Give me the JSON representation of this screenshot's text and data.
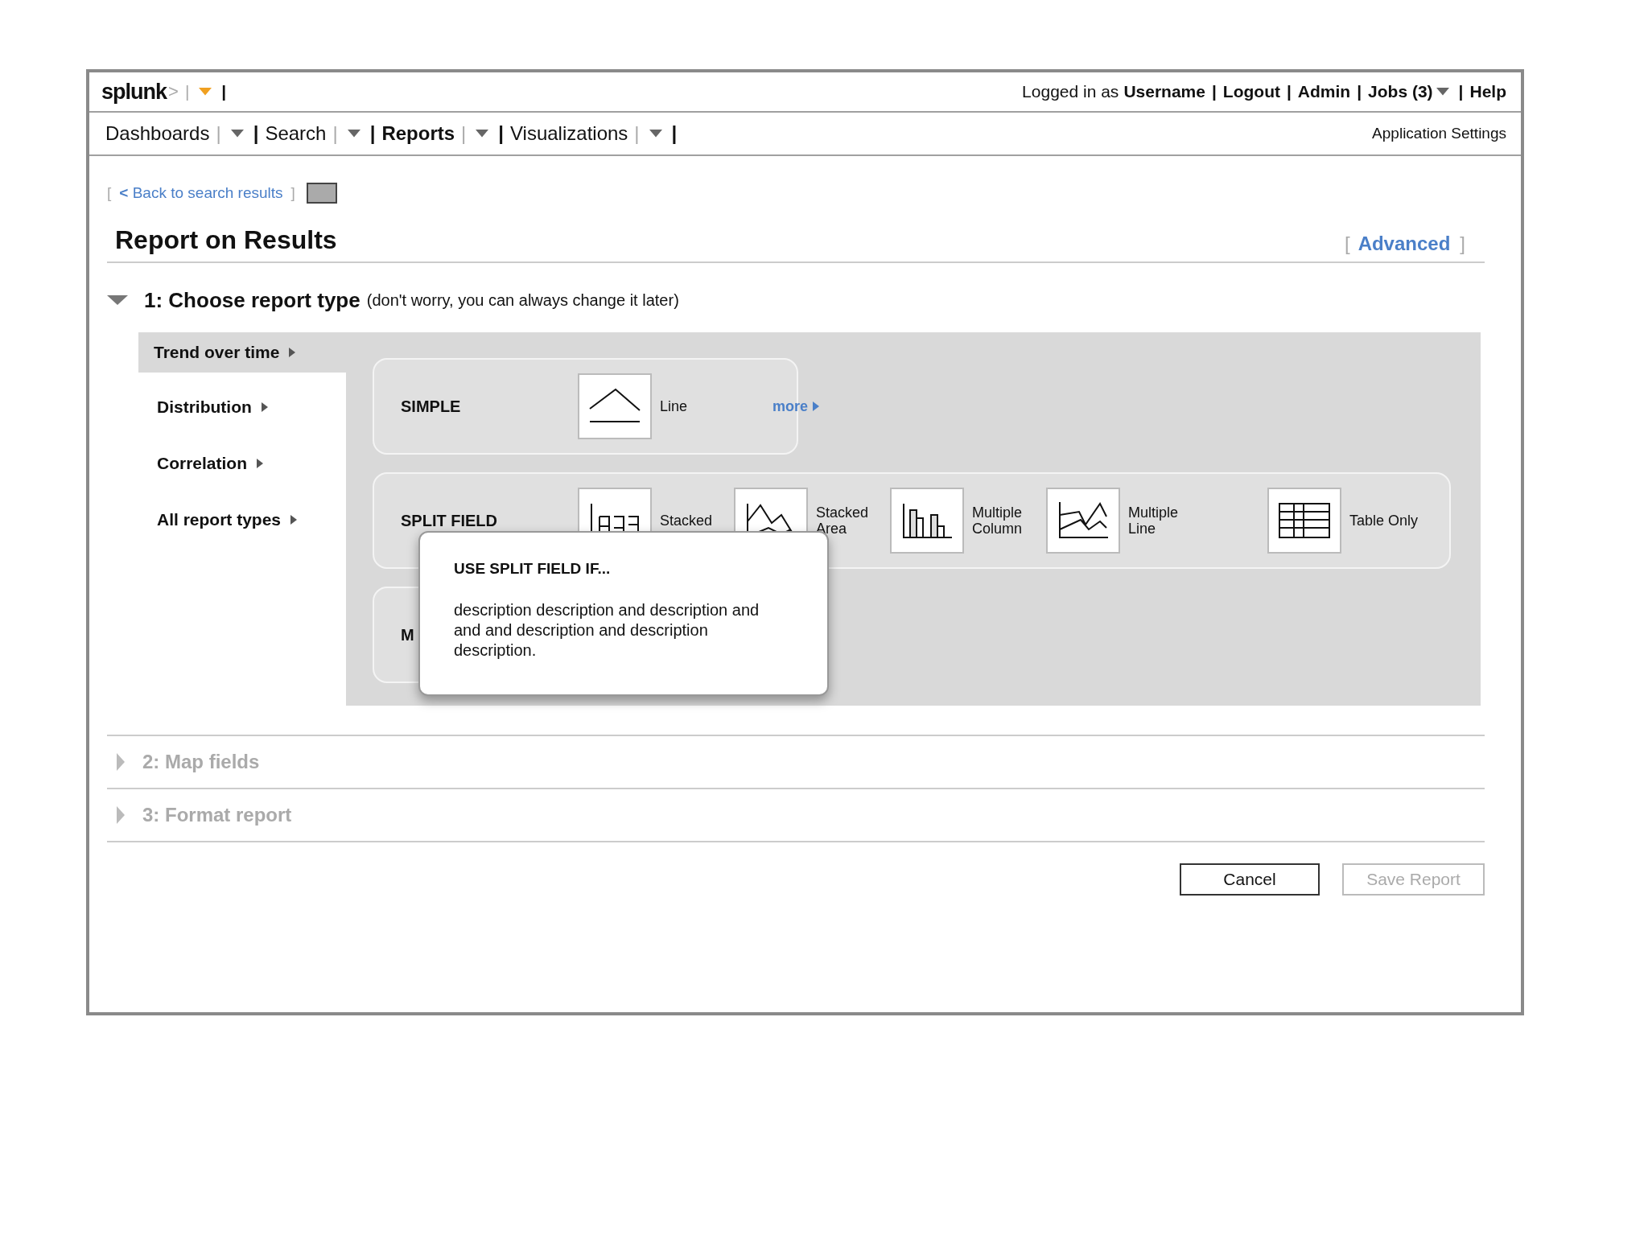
{
  "header": {
    "logo": "splunk",
    "logo_mark": ">",
    "divider": "|",
    "end": "|",
    "account": [
      {
        "kind": "text",
        "text": "Logged in as"
      },
      {
        "kind": "link",
        "text": "Username"
      },
      {
        "kind": "sep",
        "text": "|"
      },
      {
        "kind": "link",
        "text": "Logout"
      },
      {
        "kind": "sep",
        "text": "|"
      },
      {
        "kind": "link",
        "text": "Admin"
      },
      {
        "kind": "sep",
        "text": "|"
      },
      {
        "kind": "link",
        "text": "Jobs (3)"
      },
      {
        "kind": "caret"
      },
      {
        "kind": "sep",
        "text": "|"
      },
      {
        "kind": "link",
        "text": "Help"
      }
    ]
  },
  "nav": {
    "menus": [
      {
        "label": "Dashboards",
        "selected": false,
        "divider": "|",
        "end": "|"
      },
      {
        "label": "Search",
        "selected": false,
        "divider": "|",
        "end": "|"
      },
      {
        "label": "Reports",
        "selected": true,
        "divider": "|",
        "end": "|"
      },
      {
        "label": "Visualizations",
        "selected": false,
        "divider": "|",
        "end": "|"
      }
    ],
    "settings": "Application Settings"
  },
  "back_link": {
    "open": "[",
    "arrow": "<",
    "label": "Back to search results",
    "close": "]"
  },
  "page_title": "Report on Results",
  "advanced": {
    "open": "[",
    "label": "Advanced",
    "close": "]"
  },
  "steps": [
    {
      "title": "1: Choose report type",
      "note": "(don't worry, you can always change it later)",
      "expanded": true
    },
    {
      "title": "2: Map fields",
      "expanded": false
    },
    {
      "title": "3: Format report",
      "expanded": false
    }
  ],
  "categories": [
    {
      "label": "Trend over time",
      "selected": true
    },
    {
      "label": "Distribution",
      "selected": false
    },
    {
      "label": "Correlation",
      "selected": false
    },
    {
      "label": "All report types",
      "selected": false
    }
  ],
  "groups": [
    {
      "label": "SIMPLE",
      "more": "more",
      "types": [
        {
          "kind": "line",
          "label": "Line"
        }
      ]
    },
    {
      "label": "SPLIT FIELD",
      "types": [
        {
          "kind": "stacked_column",
          "label": "Stacked"
        },
        {
          "kind": "stacked_area",
          "label": "Stacked Area"
        },
        {
          "kind": "multi_column",
          "label": "Multiple Column"
        },
        {
          "kind": "multi_line",
          "label": "Multiple Line"
        },
        {
          "kind": "table",
          "label": "Table Only"
        }
      ]
    },
    {
      "label": "M"
    }
  ],
  "tooltip": {
    "title": "USE SPLIT FIELD IF...",
    "body": "description description and description and and and description and description description."
  },
  "buttons": [
    {
      "label": "Cancel",
      "disabled": false
    },
    {
      "label": "Save Report",
      "disabled": true
    }
  ]
}
